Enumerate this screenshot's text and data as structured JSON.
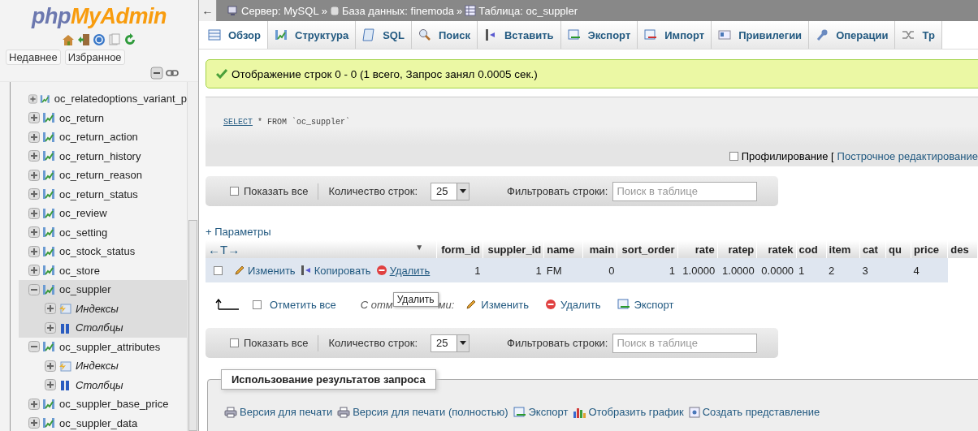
{
  "sidebar": {
    "logo": {
      "php": "php",
      "brand": "MyAdmin"
    },
    "quick_icons": [
      {
        "kind": "home"
      },
      {
        "kind": "exit"
      },
      {
        "kind": "help"
      },
      {
        "kind": "docs"
      },
      {
        "kind": "reload"
      }
    ],
    "tabs": [
      {
        "label": "Недавнее"
      },
      {
        "label": "Избранное"
      }
    ],
    "tree": [
      {
        "label": "oc_relatedoptions_variant_p",
        "expanded": false,
        "selected": false
      },
      {
        "label": "oc_return",
        "expanded": false,
        "selected": false
      },
      {
        "label": "oc_return_action",
        "expanded": false,
        "selected": false
      },
      {
        "label": "oc_return_history",
        "expanded": false,
        "selected": false
      },
      {
        "label": "oc_return_reason",
        "expanded": false,
        "selected": false
      },
      {
        "label": "oc_return_status",
        "expanded": false,
        "selected": false
      },
      {
        "label": "oc_review",
        "expanded": false,
        "selected": false
      },
      {
        "label": "oc_setting",
        "expanded": false,
        "selected": false
      },
      {
        "label": "oc_stock_status",
        "expanded": false,
        "selected": false
      },
      {
        "label": "oc_store",
        "expanded": false,
        "selected": false
      },
      {
        "label": "oc_suppler",
        "expanded": true,
        "selected": true,
        "children": [
          {
            "label": "Индексы",
            "kind": "indexes"
          },
          {
            "label": "Столбцы",
            "kind": "columns"
          }
        ]
      },
      {
        "label": "oc_suppler_attributes",
        "expanded": true,
        "selected": false,
        "children": [
          {
            "label": "Индексы",
            "kind": "indexes"
          },
          {
            "label": "Столбцы",
            "kind": "columns"
          }
        ]
      },
      {
        "label": "oc_suppler_base_price",
        "expanded": false,
        "selected": false
      },
      {
        "label": "oc_suppler_data",
        "expanded": false,
        "selected": false
      }
    ]
  },
  "back": "←",
  "breadcrumb": [
    {
      "label": "Сервер: MySQL",
      "kind": "server"
    },
    {
      "label": "База данных: finemoda",
      "kind": "database"
    },
    {
      "label": "Таблица: oc_suppler",
      "kind": "table"
    }
  ],
  "breadcrumb_separator": "»",
  "tabs": [
    {
      "label": "Обзор",
      "kind": "browse",
      "selected": true
    },
    {
      "label": "Структура",
      "kind": "structure",
      "selected": false
    },
    {
      "label": "SQL",
      "kind": "sql",
      "selected": false
    },
    {
      "label": "Поиск",
      "kind": "search",
      "selected": false
    },
    {
      "label": "Вставить",
      "kind": "insert",
      "selected": false
    },
    {
      "label": "Экспорт",
      "kind": "export",
      "selected": false
    },
    {
      "label": "Импорт",
      "kind": "import",
      "selected": false
    },
    {
      "label": "Привилегии",
      "kind": "privileges",
      "selected": false
    },
    {
      "label": "Операции",
      "kind": "operations",
      "selected": false
    },
    {
      "label": "Тр",
      "kind": "tracking",
      "selected": false
    }
  ],
  "message": "Отображение строк 0 - 0 (1 всего, Запрос занял 0.0005 сек.)",
  "sql": {
    "keyword": "SELECT",
    "rest": "* FROM `oc_suppler`"
  },
  "profiling": {
    "label": "Профилирование [",
    "checked": false,
    "link": "Построчное редактирование"
  },
  "nav_bars": [
    {
      "show_all": {
        "label": "Показать все",
        "checked": false
      },
      "rows_label": "Количество строк:",
      "rows_value": "25",
      "filter_label": "Фильтровать строки:",
      "filter_placeholder": "Поиск в таблице"
    },
    {
      "show_all": {
        "label": "Показать все",
        "checked": false
      },
      "rows_label": "Количество строк:",
      "rows_value": "25",
      "filter_label": "Фильтровать строки:",
      "filter_placeholder": "Поиск в таблице"
    }
  ],
  "options_link": "+ Параметры",
  "table": {
    "resize_handle": "←T→",
    "sort_caret": "▼",
    "columns": [
      "form_id",
      "suppler_id",
      "name",
      "main",
      "sort_order",
      "rate",
      "ratep",
      "ratek",
      "cod",
      "item",
      "cat",
      "qu",
      "price",
      "des"
    ],
    "rows": [
      {
        "checked": false,
        "actions": [
          {
            "label": "Изменить",
            "kind": "edit"
          },
          {
            "label": "Копировать",
            "kind": "copy"
          },
          {
            "label": "Удалить",
            "kind": "delete"
          }
        ],
        "cells": [
          "1",
          "1",
          "FM",
          "0",
          "1",
          "1.0000",
          "1.0000",
          "0.0000",
          "1",
          "2",
          "3",
          null,
          "4"
        ]
      }
    ]
  },
  "tooltip": "Удалить",
  "bulk": {
    "check_all": {
      "label": "Отметить все",
      "checked": false
    },
    "with_selected_visible": [
      "С отм",
      "ми:"
    ],
    "actions": [
      {
        "label": "Изменить",
        "kind": "edit"
      },
      {
        "label": "Удалить",
        "kind": "delete"
      },
      {
        "label": "Экспорт",
        "kind": "export"
      }
    ]
  },
  "query_results": {
    "legend": "Использование результатов запроса",
    "links": [
      {
        "label": "Версия для печати",
        "kind": "print"
      },
      {
        "label": "Версия для печати (полностью)",
        "kind": "print"
      },
      {
        "label": "Экспорт",
        "kind": "export"
      },
      {
        "label": "Отобразить график",
        "kind": "chart"
      },
      {
        "label": "Создать представление",
        "kind": "view"
      }
    ]
  }
}
